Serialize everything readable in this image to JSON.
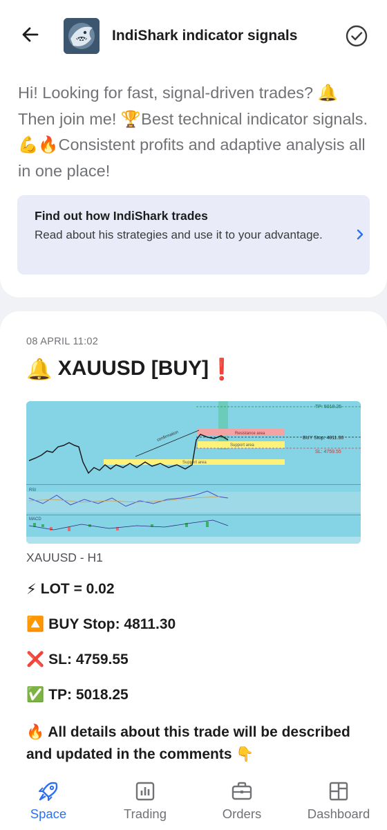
{
  "header": {
    "title": "IndiShark indicator signals",
    "back_icon": "arrow-left-icon",
    "check_icon": "check-circle-icon",
    "avatar_icon": "shark-logo-icon"
  },
  "intro": {
    "text": "Hi! Looking for fast, signal-driven trades? 🔔Then join me! 🏆Best technical indicator signals. 💪🔥Consistent profits and adaptive analysis all in one place!"
  },
  "learn_card": {
    "title": "Find out how IndiShark trades",
    "subtitle": "Read about his strategies and use it to your advantage.",
    "chevron_icon": "chevron-right-icon"
  },
  "post": {
    "date": "08 APRIL 11:02",
    "headline_emoji": "🔔",
    "headline": "XAUUSD [BUY]",
    "headline_emoji_end": "❗",
    "chart": {
      "labels": {
        "tp": "TP: 5018.25",
        "buy_stop": "BUY Stop: 4811.30",
        "sl": "SL: 4759.55",
        "resistance": "Resistance area",
        "support": "Support area",
        "support2": "Support area",
        "confirmation": "confirmation",
        "rsi": "RSI",
        "macd": "MACD"
      },
      "colors": {
        "background": "#84d4e6",
        "tp": "#4cbb6c",
        "sl": "#e05a5a",
        "support": "#fff27a",
        "resistance": "#f3a3a3"
      }
    },
    "caption": "XAUUSD - H1",
    "lot": {
      "emoji": "⚡",
      "text": "LOT = 0.02"
    },
    "buy_stop": {
      "emoji": "🔼",
      "text": "BUY Stop: 4811.30"
    },
    "sl": {
      "emoji": "❌",
      "text": "SL: 4759.55"
    },
    "tp": {
      "emoji": "✅",
      "text": "TP: 5018.25"
    },
    "details": {
      "emoji": "🔥",
      "text": "All details about this trade will be described and updated in the comments",
      "emoji_end": "👇"
    }
  },
  "nav": {
    "items": [
      {
        "label": "Space",
        "icon": "rocket-icon",
        "active": true
      },
      {
        "label": "Trading",
        "icon": "chart-icon",
        "active": false
      },
      {
        "label": "Orders",
        "icon": "briefcase-icon",
        "active": false
      },
      {
        "label": "Dashboard",
        "icon": "dashboard-icon",
        "active": false
      }
    ]
  }
}
